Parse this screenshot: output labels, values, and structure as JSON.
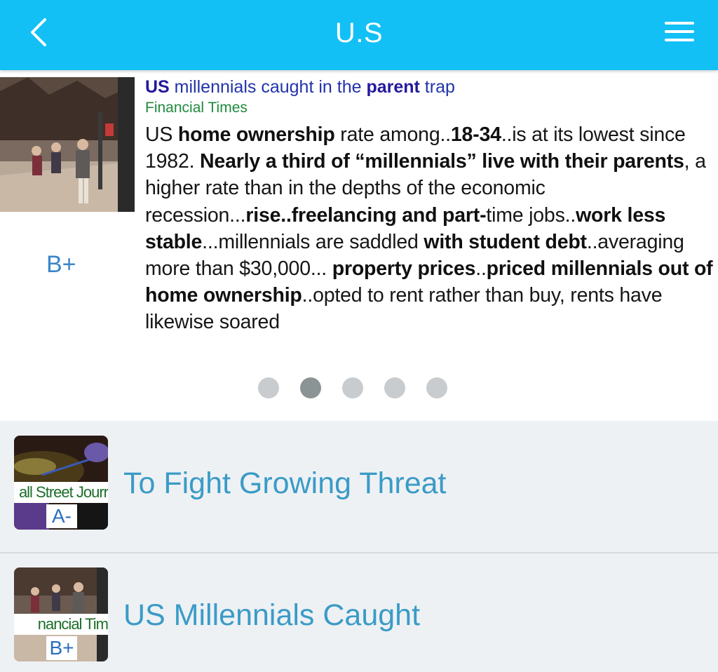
{
  "header": {
    "title": "U.S",
    "back_icon": "chevron-left-icon",
    "menu_icon": "hamburger-menu-icon",
    "background_color": "#12c0f5"
  },
  "featured": {
    "headline": {
      "w1": "US",
      "w2": " millennials caught in the ",
      "w3": "parent",
      "w4": " trap"
    },
    "source": "Financial Times",
    "grade": "B+",
    "summary": [
      {
        "bold": false,
        "text": "US "
      },
      {
        "bold": true,
        "text": "home ownership"
      },
      {
        "bold": false,
        "text": " rate among.."
      },
      {
        "bold": true,
        "text": "18-34"
      },
      {
        "bold": false,
        "text": "..is at its lowest since 1982. "
      },
      {
        "bold": true,
        "text": "Nearly a third of “millennials” live with their parents"
      },
      {
        "bold": false,
        "text": ", a higher rate than in the depths of the economic recession..."
      },
      {
        "bold": true,
        "text": "rise..freelancing and part-"
      },
      {
        "bold": false,
        "text": "time jobs.."
      },
      {
        "bold": true,
        "text": "work less stable"
      },
      {
        "bold": false,
        "text": "...millennials are saddled "
      },
      {
        "bold": true,
        "text": "with student debt"
      },
      {
        "bold": false,
        "text": "..averaging more than $30,000... "
      },
      {
        "bold": true,
        "text": "property prices"
      },
      {
        "bold": false,
        "text": ".."
      },
      {
        "bold": true,
        "text": "priced millennials out of home ownership"
      },
      {
        "bold": false,
        "text": "..opted to rent rather than buy, rents have likewise soared"
      }
    ],
    "carousel": {
      "count": 5,
      "active_index": 1
    }
  },
  "list": [
    {
      "title": "To Fight Growing Threat",
      "thumb_source": "all Street Jourr",
      "grade": "A-"
    },
    {
      "title": "US Millennials Caught",
      "thumb_source": "nancial Tim",
      "grade": "B+"
    }
  ]
}
